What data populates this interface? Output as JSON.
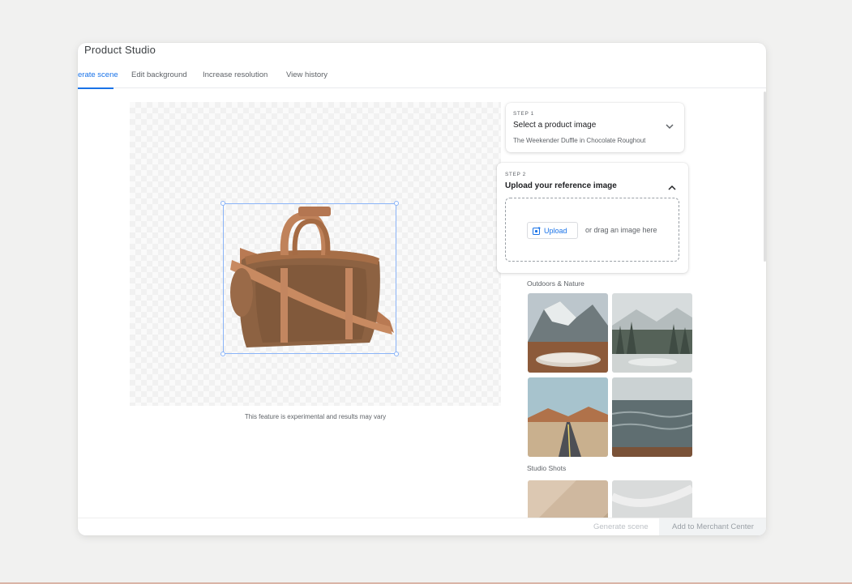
{
  "app": {
    "title": "Product Studio"
  },
  "tabs": [
    {
      "label": "erate scene",
      "active": true
    },
    {
      "label": "Edit background",
      "active": false
    },
    {
      "label": "Increase resolution",
      "active": false
    },
    {
      "label": "View history",
      "active": false
    }
  ],
  "canvas": {
    "caption": "This feature is experimental and results may vary"
  },
  "step1": {
    "step_label": "STEP 1",
    "title": "Select a product image",
    "selected": "The Weekender Duffle in Chocolate Roughout",
    "icon": "chevron-down-icon"
  },
  "step2": {
    "step_label": "STEP 2",
    "title": "Upload your reference image",
    "icon": "chevron-up-icon",
    "upload_label": "Upload",
    "upload_icon": "add-photo-icon",
    "drag_text": "or drag an image here"
  },
  "gallery": {
    "section1": "Outdoors & Nature",
    "section1_items": [
      "mountain-lake-scene",
      "foggy-forest-scene",
      "desert-road-scene",
      "ocean-shore-scene"
    ],
    "section2": "Studio Shots",
    "section2_items": [
      "beige-fabric-scene",
      "white-fabric-scene"
    ]
  },
  "footer": {
    "generate_label": "Generate scene",
    "add_label": "Add to Merchant Center"
  },
  "colors": {
    "accent": "#1a73e8",
    "background": "#f1f1f0"
  }
}
